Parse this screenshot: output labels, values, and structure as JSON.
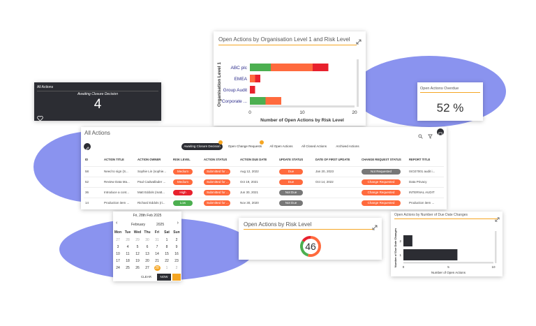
{
  "colors": {
    "accent": "#f5a623",
    "blob": "#8a93ef",
    "dark_card": "#2c2d33",
    "green": "#4caf50",
    "orange": "#ff6a3d",
    "red": "#e8212d",
    "grey": "#777777",
    "navy": "#2c2d33"
  },
  "org_chart": {
    "title": "Open Actions by Organisation Level 1 and Risk Level",
    "expand_icon": "expand-icon"
  },
  "chart_data": [
    {
      "type": "bar",
      "orientation": "horizontal",
      "stacked": true,
      "title": "Open Actions by Organisation Level 1 and Risk Level",
      "xlabel": "Number of Open Actions by Risk Level",
      "ylabel": "Organisation Level 1",
      "categories": [
        "ABC plc",
        "EMEA",
        "Group Audit",
        "Corporate ..."
      ],
      "series": [
        {
          "color": "#4caf50",
          "values": [
            4,
            0,
            0,
            3
          ]
        },
        {
          "color": "#ff6a3d",
          "values": [
            8,
            1,
            0,
            3
          ]
        },
        {
          "color": "#e8212d",
          "values": [
            3,
            1,
            1,
            0
          ]
        }
      ],
      "xlim": [
        0,
        20
      ],
      "xticks": [
        "0",
        "10",
        "20"
      ]
    },
    {
      "type": "bar",
      "orientation": "horizontal",
      "title": "Open Actions by Number of Due Date Changes",
      "xlabel": "Number of Open Actions",
      "ylabel": "Number of Due Date Changes",
      "categories": [
        "2",
        "1"
      ],
      "values": [
        1,
        6
      ],
      "xlim": [
        0,
        10
      ],
      "xticks": [
        "0",
        "5",
        "10"
      ]
    },
    {
      "type": "pie",
      "title": "Open Actions by Risk Level",
      "total": "46",
      "series": [
        {
          "color": "#ff6a3d",
          "value": 25
        },
        {
          "color": "#4caf50",
          "value": 14
        },
        {
          "color": "#e8212d",
          "value": 7
        }
      ]
    }
  ],
  "all_actions_card": {
    "title": "All Actions",
    "subtitle": "Awaiting Closure Decision",
    "value": "4"
  },
  "overdue_card": {
    "title": "Open Actions Overdue",
    "value": "52 %"
  },
  "main": {
    "title": "All Actions",
    "tabs": [
      {
        "label": "Awaiting Closure Decision",
        "active": true,
        "badge": true
      },
      {
        "label": "Open Change Requests",
        "active": false,
        "badge": true
      },
      {
        "label": "All Open Actions",
        "active": false
      },
      {
        "label": "All Closed Actions",
        "active": false
      },
      {
        "label": "Archived Actions",
        "active": false
      }
    ],
    "columns": [
      "ID",
      "ACTION TITLE",
      "ACTION OWNER",
      "RISK LEVEL",
      "ACTION STATUS",
      "ACTION DUE DATE",
      "UPDATE STATUS",
      "DATE OF FIRST UPDATE",
      "CHANGE REQUEST STATUS",
      "REPORT TITLE"
    ],
    "rows": [
      {
        "id": "58",
        "title": "Need to sign (S...",
        "owner": "Sophie Lin (sophie...",
        "risk": "Medium",
        "risk_color": "#ff6a3d",
        "status": "Submitted for ...",
        "due": "Aug 12, 2022",
        "update": "Due",
        "update_color": "#ff6a3d",
        "first_update": "Jan 20, 2023",
        "change": "Not Requested",
        "change_color": "#777777",
        "report": "ISO27001 audit i..."
      },
      {
        "id": "52",
        "title": "Review Data Ma...",
        "owner": "Paul Cadwallader ...",
        "risk": "Medium",
        "risk_color": "#ff6a3d",
        "status": "Submitted for ...",
        "due": "Oct 19, 2021",
        "update": "Due",
        "update_color": "#ff6a3d",
        "first_update": "Oct 14, 2022",
        "change": "Change Requested",
        "change_color": "#ff6a3d",
        "report": "Data Privacy"
      },
      {
        "id": "36",
        "title": "Introduce a cont...",
        "owner": "Matt Eddols (matt...",
        "risk": "High",
        "risk_color": "#e8212d",
        "status": "Submitted for ...",
        "due": "Jun 30, 2021",
        "update": "Not Due",
        "update_color": "#777777",
        "first_update": "",
        "change": "Change Requested",
        "change_color": "#ff6a3d",
        "report": "INTERNAL AUDIT"
      },
      {
        "id": "14",
        "title": "Production item ...",
        "owner": "Richard Eddols (ri...",
        "risk": "Low",
        "risk_color": "#4caf50",
        "status": "Submitted for ...",
        "due": "Nov 30, 2020",
        "update": "Not Due",
        "update_color": "#777777",
        "first_update": "",
        "change": "Change Requested",
        "change_color": "#ff6a3d",
        "report": "Production item ..."
      }
    ]
  },
  "calendar": {
    "header": "Fri, 28th Feb 2025",
    "month": "February",
    "year": "2025",
    "prev": "‹",
    "next": "›",
    "weekdays": [
      "Mon",
      "Tue",
      "Wed",
      "Thu",
      "Fri",
      "Sat",
      "Sun"
    ],
    "days": [
      [
        "27",
        "28",
        "29",
        "30",
        "31",
        "1",
        "2"
      ],
      [
        "3",
        "4",
        "5",
        "6",
        "7",
        "8",
        "9"
      ],
      [
        "10",
        "11",
        "12",
        "13",
        "14",
        "15",
        "16"
      ],
      [
        "17",
        "18",
        "19",
        "20",
        "21",
        "22",
        "23"
      ],
      [
        "24",
        "25",
        "26",
        "27",
        "28",
        "1",
        "2"
      ]
    ],
    "selected": "28",
    "clear_label": "CLEAR",
    "now_label": "NOW"
  }
}
